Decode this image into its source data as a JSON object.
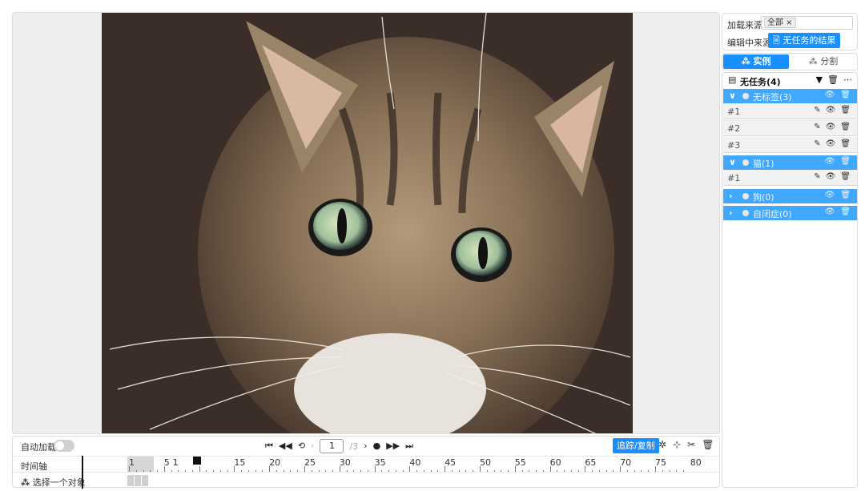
{
  "player": {
    "autoload_label": "自动加载",
    "frame_value": "1",
    "frame_total": "/3",
    "track_copy_label": "追踪/复制",
    "timeline_label": "时间轴",
    "select_object_label": "选择一个对象",
    "ruler_labels": [
      "1",
      "5",
      "1",
      "15",
      "20",
      "25",
      "30",
      "35",
      "40",
      "45",
      "50",
      "55",
      "60",
      "65",
      "70",
      "75",
      "80"
    ],
    "icons": {
      "first": "⏮",
      "prev": "◀◀",
      "undo": "⟲",
      "prev_frame": "‹",
      "next_frame": "›",
      "play": "●",
      "next": "▶▶",
      "last": "⏭",
      "settings": "✲",
      "split": "⊹",
      "cut": "✂",
      "delete": "🗑"
    }
  },
  "sidebar": {
    "load_source_label": "加载来源",
    "load_source_tag": "全部 ×",
    "edit_source_label": "编辑中来源",
    "edit_source_button": "无任务的结果",
    "tabs": [
      "实例",
      "分割"
    ],
    "task_title": "无任务(4)",
    "groups": [
      {
        "label": "无标签(3)",
        "expanded": true,
        "instances": [
          "#1",
          "#2",
          "#3"
        ]
      },
      {
        "label": "猫(1)",
        "expanded": true,
        "instances": [
          "#1"
        ]
      },
      {
        "label": "狗(0)",
        "expanded": false,
        "instances": []
      },
      {
        "label": "自闭症(0)",
        "expanded": false,
        "instances": []
      }
    ]
  },
  "colors": {
    "accent": "#1890ff",
    "group_bg": "#40a9ff"
  }
}
